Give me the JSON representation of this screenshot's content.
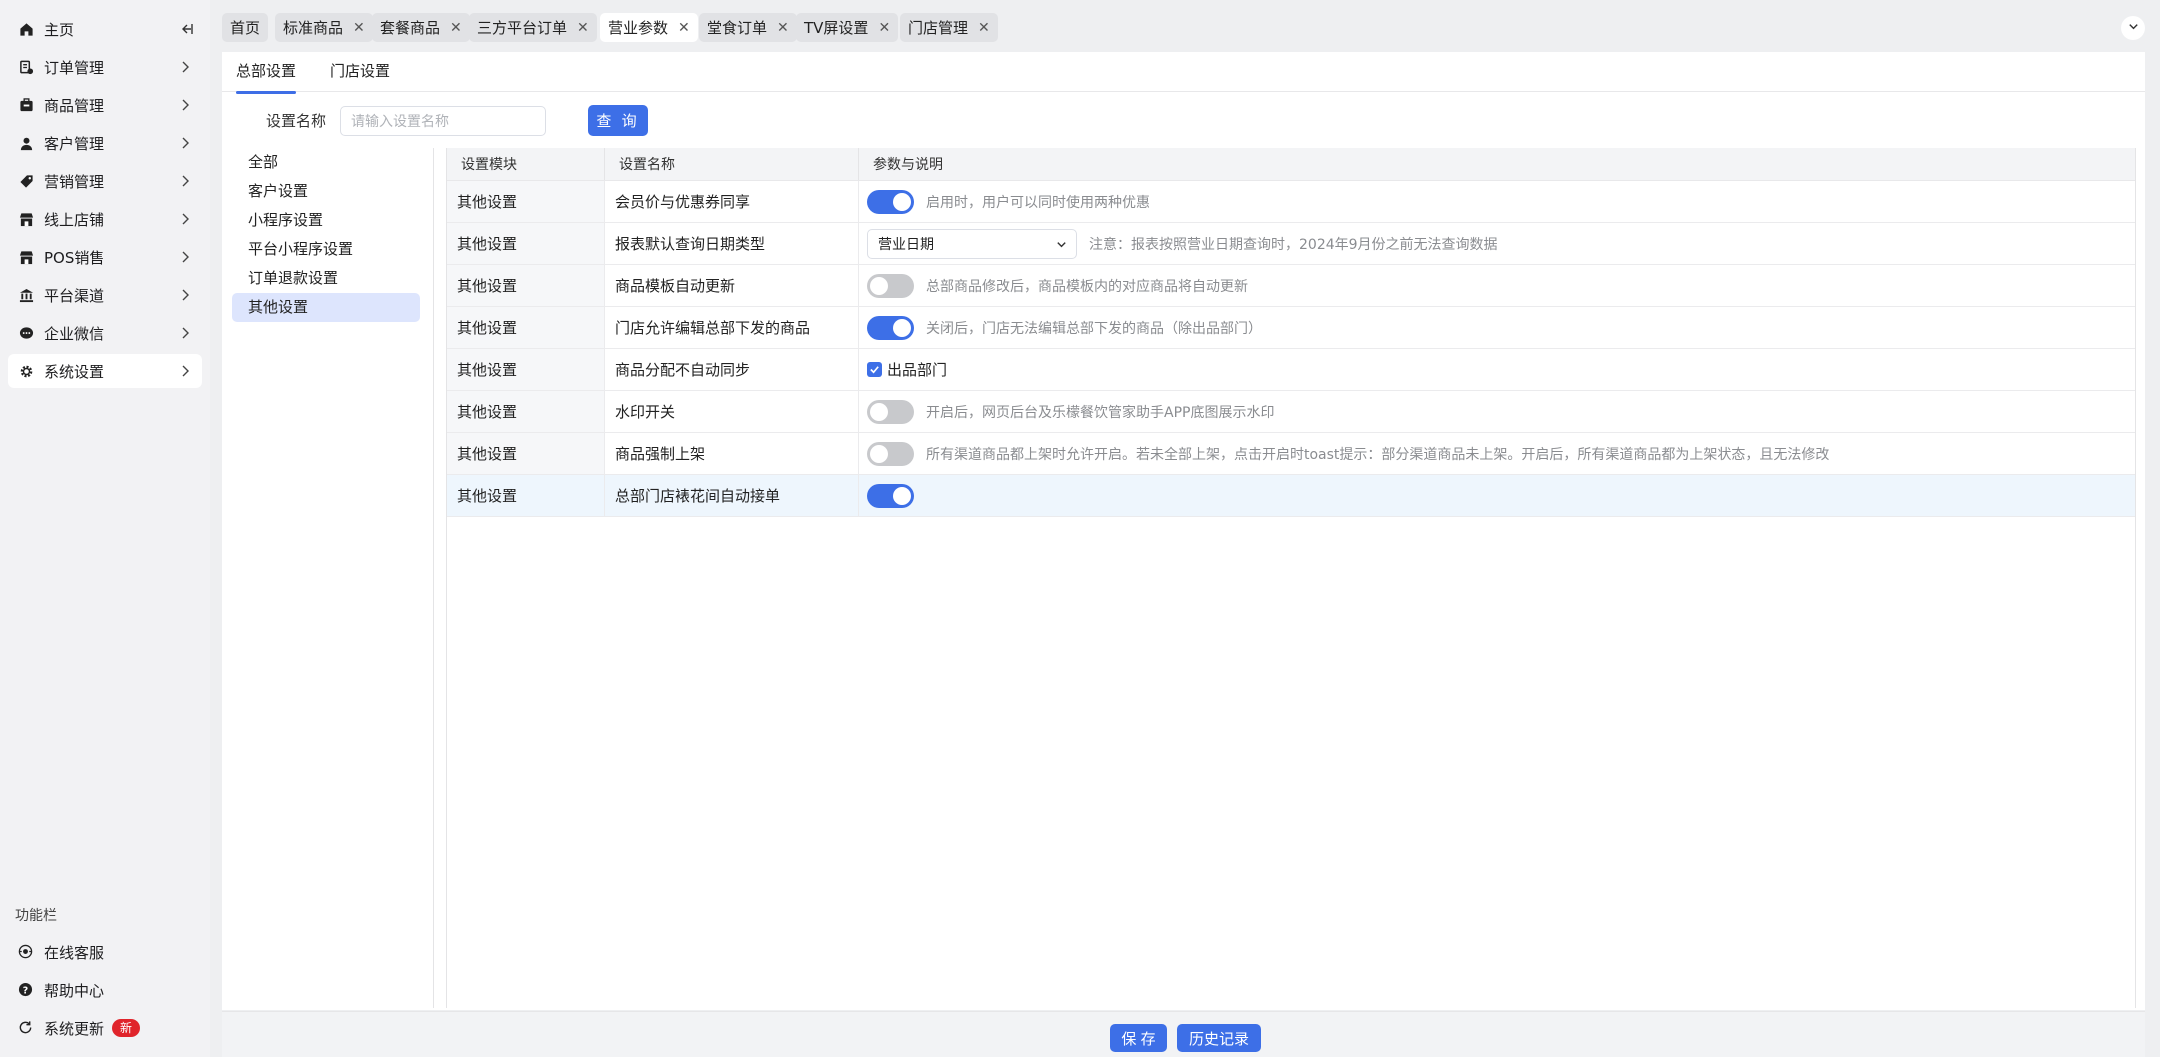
{
  "sidebar": {
    "items": [
      {
        "label": "主页",
        "icon": "home-icon"
      },
      {
        "label": "订单管理",
        "icon": "order-icon"
      },
      {
        "label": "商品管理",
        "icon": "goods-icon"
      },
      {
        "label": "客户管理",
        "icon": "user-icon"
      },
      {
        "label": "营销管理",
        "icon": "tag-icon"
      },
      {
        "label": "线上店铺",
        "icon": "store-icon"
      },
      {
        "label": "POS销售",
        "icon": "pos-icon"
      },
      {
        "label": "平台渠道",
        "icon": "bank-icon"
      },
      {
        "label": "企业微信",
        "icon": "chat-icon"
      },
      {
        "label": "系统设置",
        "icon": "gear-icon"
      }
    ],
    "func_title": "功能栏",
    "func_items": [
      {
        "label": "在线客服",
        "icon": "eye-icon"
      },
      {
        "label": "帮助中心",
        "icon": "help-icon"
      },
      {
        "label": "系统更新",
        "icon": "refresh-icon",
        "badge": "新"
      }
    ]
  },
  "tabs": [
    {
      "label": "首页"
    },
    {
      "label": "标准商品"
    },
    {
      "label": "套餐商品"
    },
    {
      "label": "三方平台订单"
    },
    {
      "label": "营业参数"
    },
    {
      "label": "堂食订单"
    },
    {
      "label": "TV屏设置"
    },
    {
      "label": "门店管理"
    }
  ],
  "subtabs": [
    "总部设置",
    "门店设置"
  ],
  "search": {
    "label": "设置名称",
    "placeholder": "请输入设置名称",
    "button": "查 询"
  },
  "categories": [
    "全部",
    "客户设置",
    "小程序设置",
    "平台小程序设置",
    "订单退款设置",
    "其他设置"
  ],
  "table": {
    "headers": [
      "设置模块",
      "设置名称",
      "参数与说明"
    ],
    "rows": [
      {
        "module": "其他设置",
        "name": "会员价与优惠券同享",
        "desc": "启用时，用户可以同时使用两种优惠"
      },
      {
        "module": "其他设置",
        "name": "报表默认查询日期类型",
        "select": "营业日期",
        "desc": "注意：报表按照营业日期查询时，2024年9月份之前无法查询数据"
      },
      {
        "module": "其他设置",
        "name": "商品模板自动更新",
        "desc": "总部商品修改后，商品模板内的对应商品将自动更新"
      },
      {
        "module": "其他设置",
        "name": "门店允许编辑总部下发的商品",
        "desc": "关闭后，门店无法编辑总部下发的商品（除出品部门）"
      },
      {
        "module": "其他设置",
        "name": "商品分配不自动同步",
        "checkbox_label": "出品部门"
      },
      {
        "module": "其他设置",
        "name": "水印开关",
        "desc": "开启后，网页后台及乐檬餐饮管家助手APP底图展示水印"
      },
      {
        "module": "其他设置",
        "name": "商品强制上架",
        "desc": "所有渠道商品都上架时允许开启。若未全部上架，点击开启时toast提示：部分渠道商品未上架。开启后，所有渠道商品都为上架状态，且无法修改"
      },
      {
        "module": "其他设置",
        "name": "总部门店裱花间自动接单"
      }
    ]
  },
  "footer": {
    "save": "保 存",
    "history": "历史记录"
  },
  "colors": {
    "accent": "#3d6fe7",
    "active_category_bg": "#dde5fd",
    "badge": "#e0242b"
  }
}
